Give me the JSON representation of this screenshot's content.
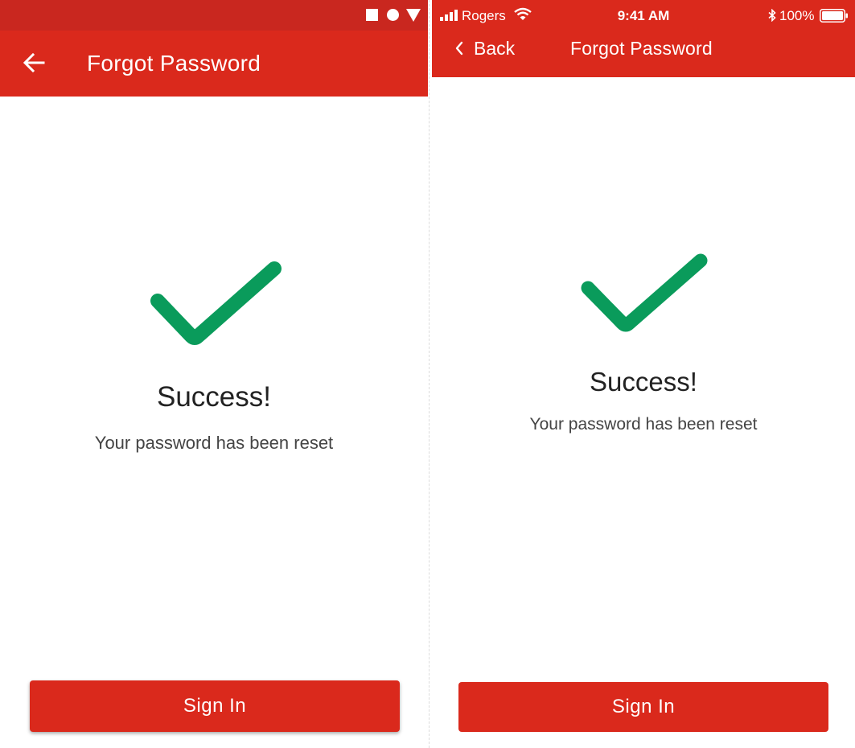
{
  "colors": {
    "brand_red": "#da291c",
    "android_status_red": "#c9271f",
    "success_green": "#0a9b5b"
  },
  "android": {
    "status_icons": [
      "square-icon",
      "circle-icon",
      "triangle-icon"
    ],
    "app_bar": {
      "back_icon": "arrow-left-icon",
      "title": "Forgot Password"
    },
    "content": {
      "icon": "checkmark-icon",
      "heading": "Success!",
      "message": "Your password has been reset"
    },
    "button_label": "Sign In"
  },
  "ios": {
    "status_bar": {
      "carrier": "Rogers",
      "time": "9:41 AM",
      "battery": "100%"
    },
    "nav_bar": {
      "back_label": "Back",
      "title": "Forgot Password"
    },
    "content": {
      "icon": "checkmark-icon",
      "heading": "Success!",
      "message": "Your password has been reset"
    },
    "button_label": "Sign In"
  }
}
